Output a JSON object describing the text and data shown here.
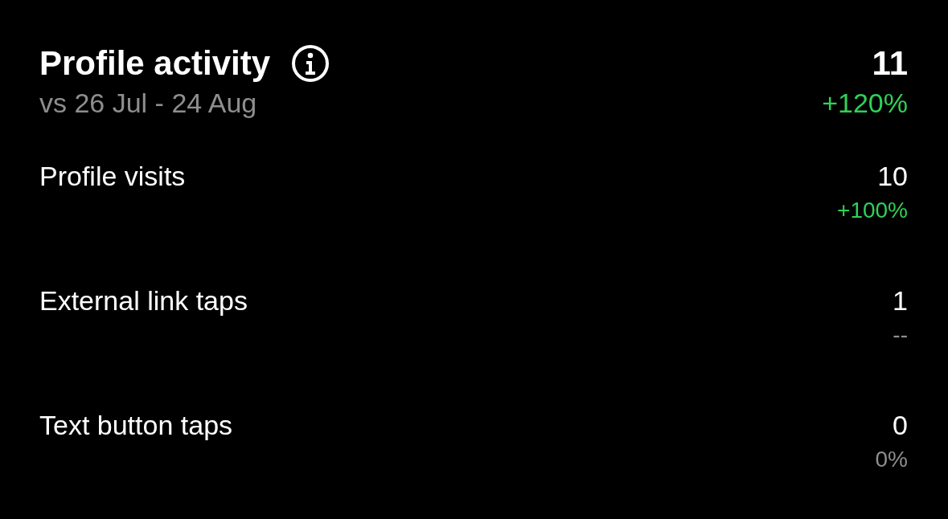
{
  "header": {
    "title": "Profile activity",
    "subtitle": "vs 26 Jul - 24 Aug",
    "value": "11",
    "change": "+120%",
    "color": "#2fd158"
  },
  "metrics": [
    {
      "label": "Profile visits",
      "value": "10",
      "change": "+100%",
      "color": "#2fd158"
    },
    {
      "label": "External link taps",
      "value": "1",
      "change": "--",
      "color": "#8e8e8e"
    },
    {
      "label": "Text button taps",
      "value": "0",
      "change": "0%",
      "color": "#8e8e8e"
    }
  ]
}
